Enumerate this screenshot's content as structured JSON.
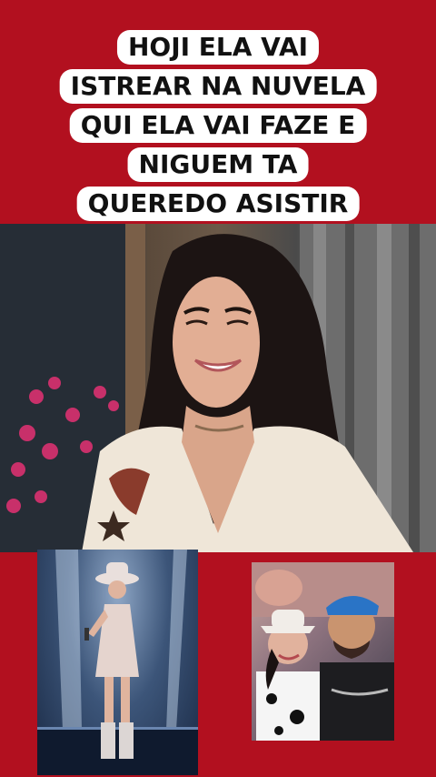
{
  "caption": {
    "lines": [
      "HOJI ELA VAI",
      "ISTREAR NA NUVELA",
      "QUI ELA VAI FAZE E",
      "NIGUEM TA",
      "QUEREDO ASISTIR"
    ]
  },
  "colors": {
    "background": "#b2101f",
    "caption_bg": "#ffffff",
    "caption_text": "#111111"
  },
  "images": {
    "main": "woman-smiling-photo",
    "inset_left": "performer-on-stage-photo",
    "inset_right": "two-people-photo"
  }
}
